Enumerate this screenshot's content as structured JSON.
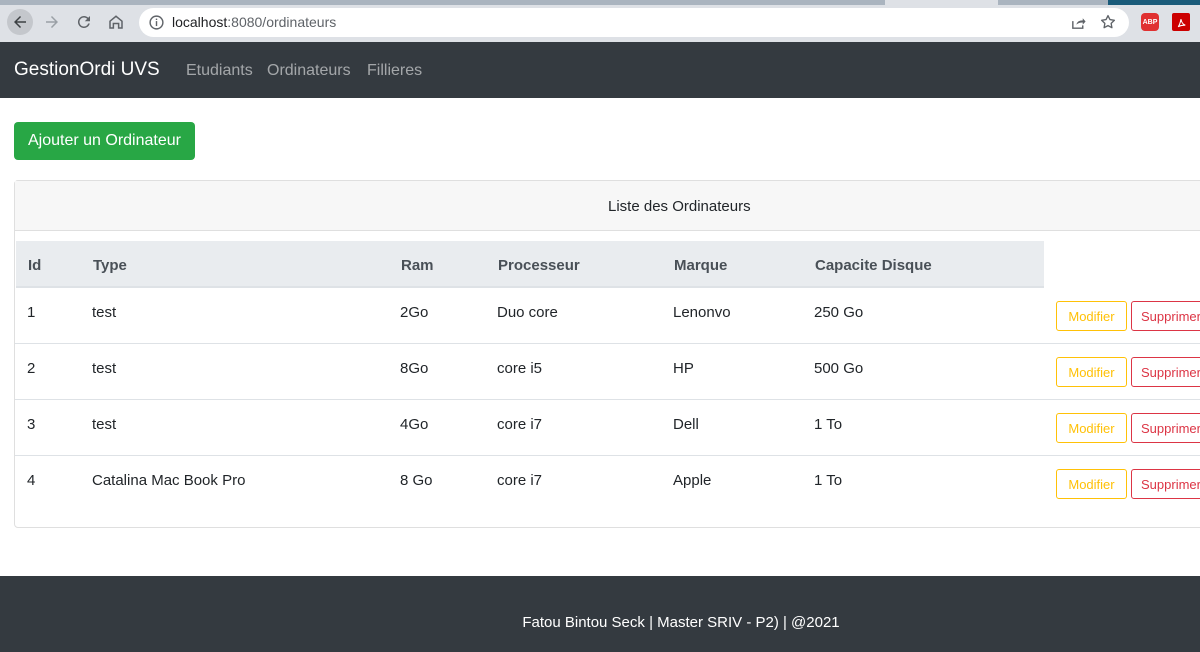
{
  "browser": {
    "url_host": "localhost",
    "url_path": ":8080/ordinateurs",
    "abp_label": "ABP"
  },
  "navbar": {
    "brand": "GestionOrdi UVS",
    "links": [
      "Etudiants",
      "Ordinateurs",
      "Fillieres"
    ]
  },
  "add_button": "Ajouter un Ordinateur",
  "card": {
    "title": "Liste des Ordinateurs",
    "columns": [
      "Id",
      "Type",
      "Ram",
      "Processeur",
      "Marque",
      "Capacite Disque"
    ],
    "rows": [
      {
        "id": "1",
        "type": "test",
        "ram": "2Go",
        "processeur": "Duo core",
        "marque": "Lenonvo",
        "capacite": "250 Go"
      },
      {
        "id": "2",
        "type": "test",
        "ram": "8Go",
        "processeur": "core i5",
        "marque": "HP",
        "capacite": "500 Go"
      },
      {
        "id": "3",
        "type": "test",
        "ram": "4Go",
        "processeur": "core i7",
        "marque": "Dell",
        "capacite": "1 To"
      },
      {
        "id": "4",
        "type": "Catalina Mac Book Pro",
        "ram": "8 Go",
        "processeur": "core i7",
        "marque": "Apple",
        "capacite": "1 To"
      }
    ],
    "modify_label": "Modifier",
    "delete_label": "Supprimer"
  },
  "footer": {
    "text": "Fatou Bintou Seck | Master SRIV - P2) | @2021"
  },
  "colors": {
    "navbar_bg": "#343a40",
    "success": "#28a745",
    "warning": "#ffc107",
    "danger": "#dc3545"
  }
}
